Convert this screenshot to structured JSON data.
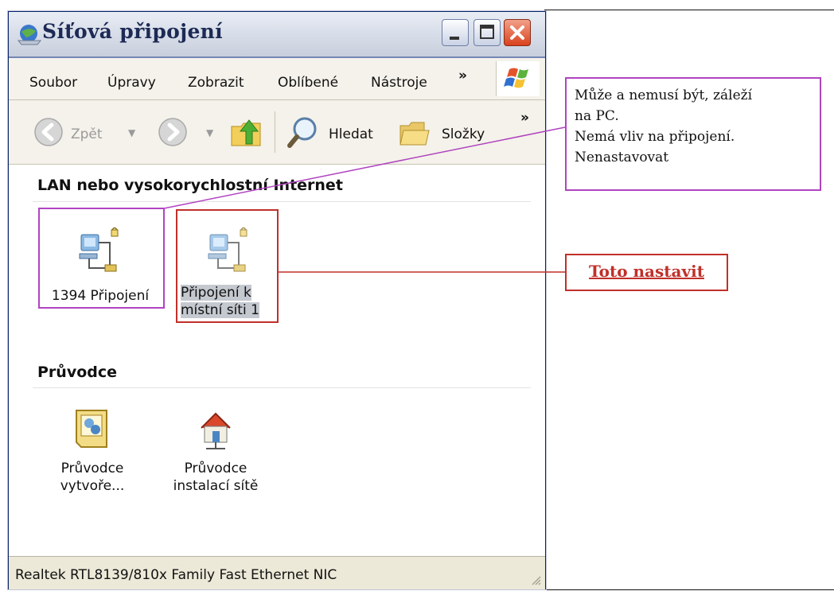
{
  "window": {
    "title": "Síťová připojení"
  },
  "menu": {
    "items": [
      "Soubor",
      "Úpravy",
      "Zobrazit",
      "Oblíbené",
      "Nástroje"
    ],
    "more": "»"
  },
  "toolbar": {
    "back_label": "Zpět",
    "search_label": "Hledat",
    "folders_label": "Složky",
    "more": "»"
  },
  "groups": {
    "lan": {
      "header": "LAN nebo vysokorychlostní Internet",
      "items": [
        {
          "label_line1": "1394 Připojení",
          "label_line2": ""
        },
        {
          "label_line1": "Připojení k",
          "label_line2": "místní síti 1"
        }
      ]
    },
    "wizards": {
      "header": "Průvodce",
      "items": [
        {
          "label_line1": "Průvodce",
          "label_line2": "vytvoře..."
        },
        {
          "label_line1": "Průvodce",
          "label_line2": "instalací sítě"
        }
      ]
    }
  },
  "status": {
    "text": "Realtek RTL8139/810x Family Fast Ethernet NIC"
  },
  "annotations": {
    "note_lines": [
      "Může a nemusí být, záleží",
      "na PC.",
      "Nemá vliv na připojení.",
      "Nenastavovat"
    ],
    "callout": "Toto nastavit",
    "colors": {
      "note_border": "#b044c0",
      "callout": "#c0302a"
    }
  }
}
